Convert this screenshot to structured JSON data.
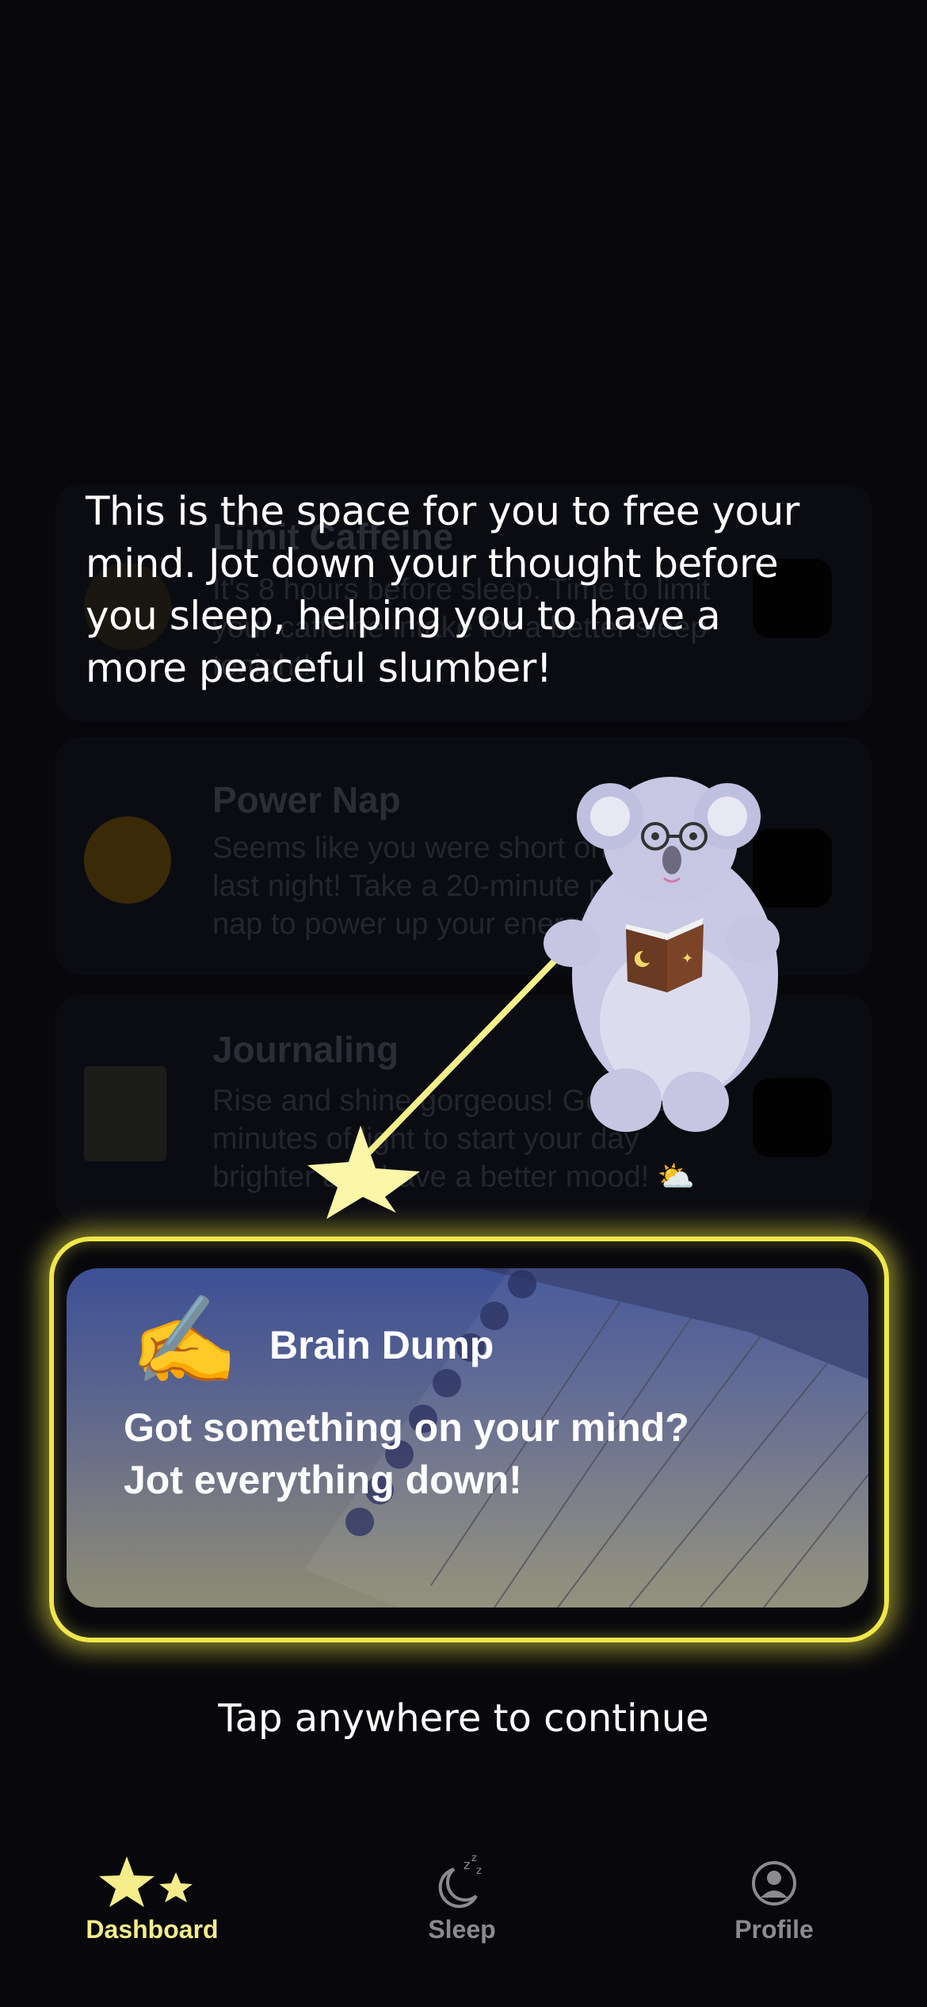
{
  "background_cards": [
    {
      "title": "Limit Caffeine",
      "body": "It's 8 hours before sleep. Time to limit your caffeine intake for a better sleep tonight!"
    },
    {
      "title": "Power Nap",
      "body": "Seems like you were short on sleep last night! Take a 20-minute power nap to power up your energy!"
    },
    {
      "title": "Journaling",
      "body": "Rise and shine gorgeous! Get a few minutes of light to start your day brighter and have a better mood! ⛅"
    }
  ],
  "tutorial": {
    "message": "This is the space for you to free your mind. Jot down your thought before you sleep, helping you to have a more peaceful slumber!",
    "continue_hint": "Tap anywhere to continue"
  },
  "highlight_card": {
    "icon": "✍️",
    "title": "Brain Dump",
    "body": "Got something on your mind? Jot everything down!"
  },
  "tabbar": {
    "items": [
      {
        "label": "Dashboard",
        "icon": "stars-icon",
        "active": true
      },
      {
        "label": "Sleep",
        "icon": "moon-zzz-icon",
        "active": false
      },
      {
        "label": "Profile",
        "icon": "profile-icon",
        "active": false
      }
    ]
  },
  "colors": {
    "background": "#08080c",
    "highlight": "#efe74a",
    "active_tab": "#f5ec8a",
    "inactive_tab": "#8a8a8f"
  }
}
